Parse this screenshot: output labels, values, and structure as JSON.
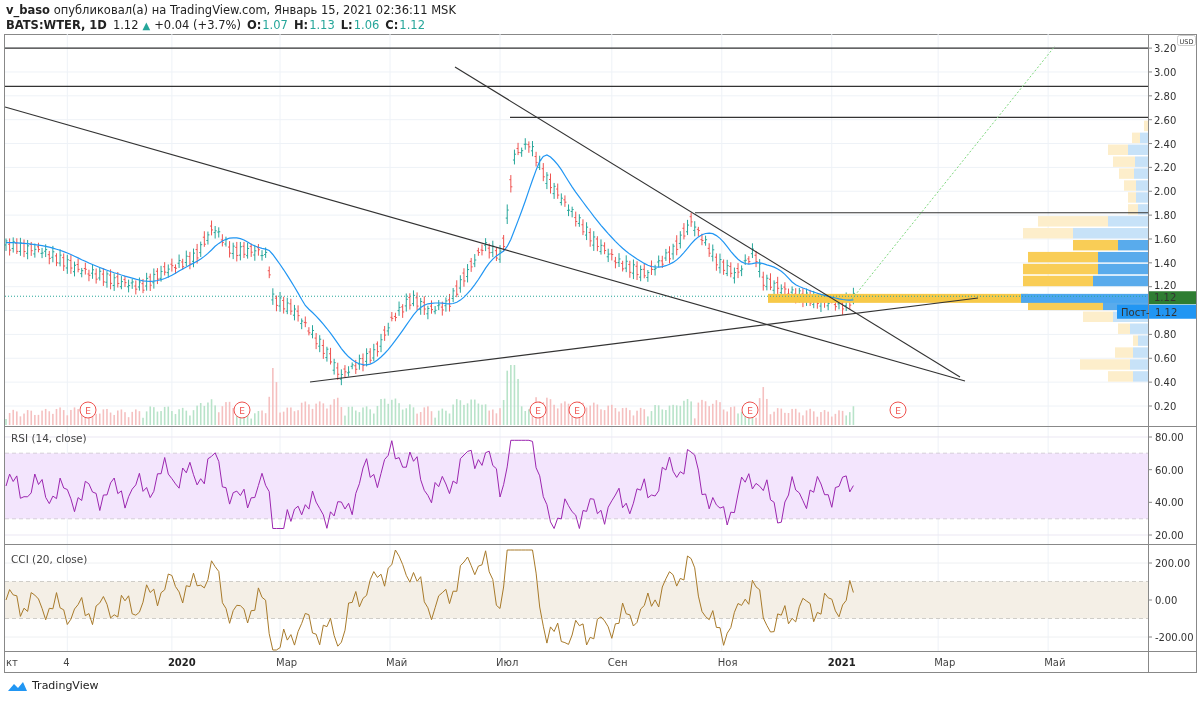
{
  "header": {
    "author": "v_baso",
    "published": "опубликовал(а) на TradingView.com, Январь 15, 2021 02:36:11 MSK"
  },
  "legend": {
    "symbol": "BATS:WTER, 1D",
    "last": "1.12",
    "arrow": "▲",
    "change": "+0.04 (+3.7%)",
    "ohlc": [
      {
        "label": "O:",
        "value": "1.07"
      },
      {
        "label": "H:",
        "value": "1.13"
      },
      {
        "label": "L:",
        "value": "1.06"
      },
      {
        "label": "C:",
        "value": "1.12"
      }
    ]
  },
  "main_pane": {
    "currency": "USD",
    "price_ticks": [
      "3.20",
      "3.00",
      "2.80",
      "2.60",
      "2.40",
      "2.20",
      "2.00",
      "1.80",
      "1.60",
      "1.40",
      "1.20",
      "0.80",
      "0.60",
      "0.40",
      "0.20"
    ],
    "last_price_label": "1.12",
    "poc_name": "Пост-",
    "poc_price": "1.12",
    "earnings_marks": [
      "E",
      "E",
      "E",
      "E",
      "E",
      "E"
    ]
  },
  "rsi_pane": {
    "title": "RSI (14, close)",
    "ticks": [
      "80.00",
      "60.00",
      "40.00",
      "20.00"
    ]
  },
  "cci_pane": {
    "title": "CCI (20, close)",
    "ticks": [
      "200.00",
      "0.00",
      "-200.00"
    ]
  },
  "time_axis": [
    {
      "label": "кт",
      "bold": false
    },
    {
      "label": "4",
      "bold": false
    },
    {
      "label": "2020",
      "bold": true
    },
    {
      "label": "Мар",
      "bold": false
    },
    {
      "label": "Май",
      "bold": false
    },
    {
      "label": "Июл",
      "bold": false
    },
    {
      "label": "Сен",
      "bold": false
    },
    {
      "label": "Ноя",
      "bold": false
    },
    {
      "label": "2021",
      "bold": true
    },
    {
      "label": "Мар",
      "bold": false
    },
    {
      "label": "Май",
      "bold": false
    }
  ],
  "footer": {
    "brand": "TradingView"
  }
}
